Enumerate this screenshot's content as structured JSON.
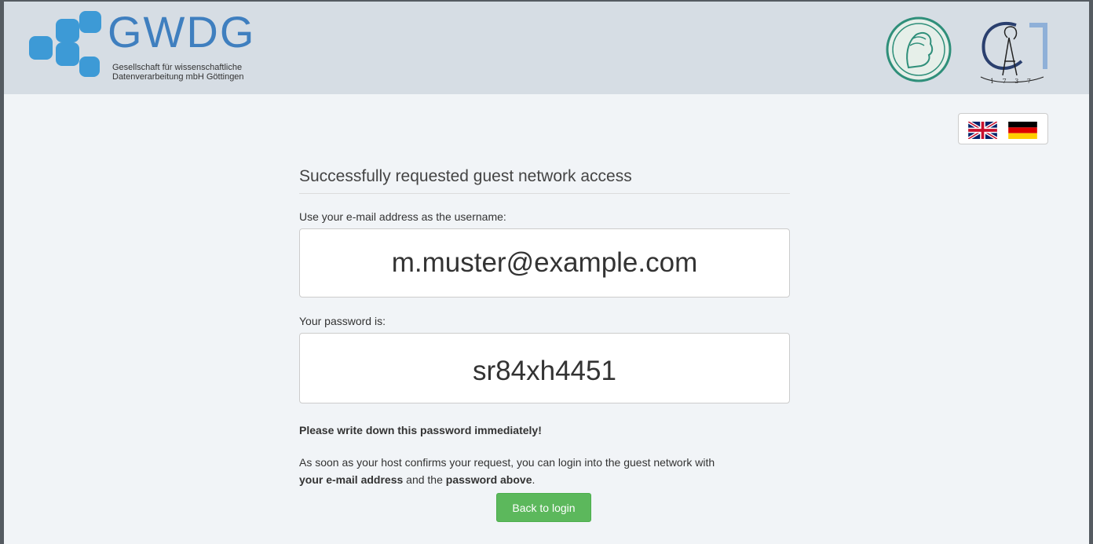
{
  "header": {
    "logo_word": "GWDG",
    "logo_line1": "Gesellschaft für wissenschaftliche",
    "logo_line2": "Datenverarbeitung mbH Göttingen",
    "seal_year": "1737",
    "colors": {
      "logo_blue": "#3f7fbf",
      "logo_cube": "#3d9ad6",
      "header_bg": "#d6dde4"
    },
    "icons": [
      "gwdg-logo-icon",
      "max-planck-seal-icon",
      "goettingen-university-seal-icon"
    ]
  },
  "language": {
    "options": [
      "English",
      "Deutsch"
    ],
    "icons": [
      "uk-flag-icon",
      "german-flag-icon"
    ]
  },
  "main": {
    "title": "Successfully requested guest network access",
    "username_label": "Use your e-mail address as the username:",
    "username_value": "m.muster@example.com",
    "password_label": "Your password is:",
    "password_value": "sr84xh4451",
    "warning": "Please write down this password immediately!",
    "info_part1": "As soon as your host confirms your request, you can login into the guest network with",
    "info_bold1": "your e-mail address",
    "info_part2": " and the ",
    "info_bold2": "password above",
    "info_part3": "."
  },
  "actions": {
    "back_label": "Back to login",
    "button_color": "#5cb85c"
  }
}
